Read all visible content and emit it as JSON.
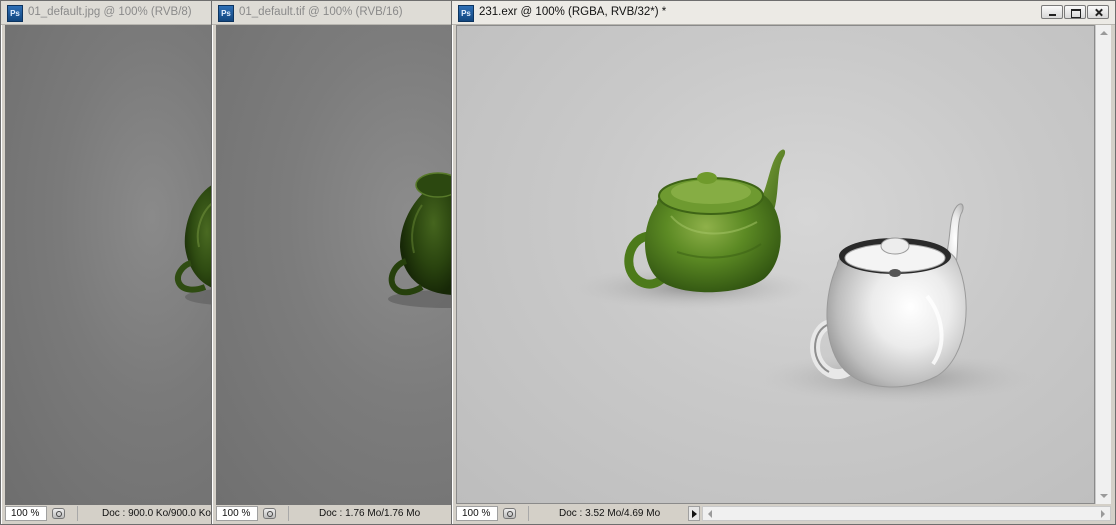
{
  "windows": [
    {
      "title": "01_default.jpg @ 100% (RVB/8)",
      "zoom": "100 %",
      "doc": "Doc : 900.0 Ko/900.0 Ko",
      "active": false
    },
    {
      "title": "01_default.tif @ 100% (RVB/16)",
      "zoom": "100 %",
      "doc": "Doc : 1.76 Mo/1.76 Mo",
      "active": false
    },
    {
      "title": "231.exr @ 100% (RGBA, RVB/32*) *",
      "zoom": "100 %",
      "doc": "Doc : 3.52 Mo/4.69 Mo",
      "active": true
    }
  ],
  "app_icon": "Ps",
  "colors": {
    "chrome": "#d4d0c8",
    "teapot_green": "#4f7a1c",
    "teapot_chrome": "#f2f2f2"
  },
  "icons": [
    "photoshop-app-icon",
    "minimize-icon",
    "restore-icon",
    "close-icon",
    "status-menu-icon",
    "arrow-right-icon"
  ]
}
